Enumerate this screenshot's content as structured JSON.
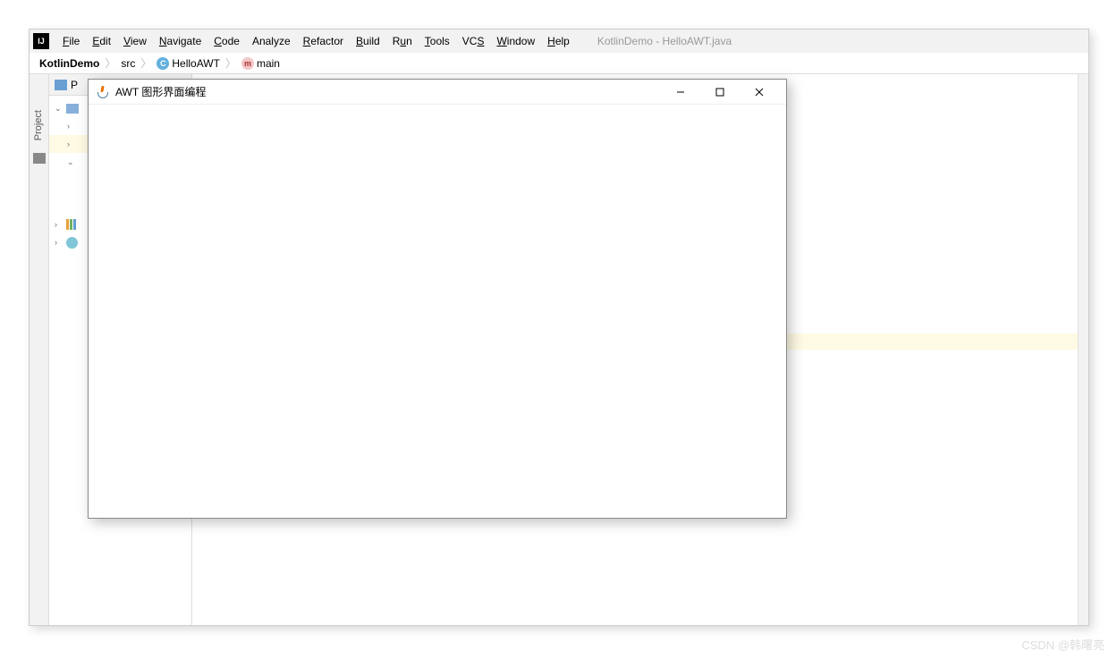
{
  "menu": {
    "items": [
      "File",
      "Edit",
      "View",
      "Navigate",
      "Code",
      "Analyze",
      "Refactor",
      "Build",
      "Run",
      "Tools",
      "VCS",
      "Window",
      "Help"
    ],
    "mnemonics": [
      "F",
      "E",
      "V",
      "N",
      "C",
      "",
      "R",
      "B",
      "R",
      "T",
      "S",
      "W",
      "H"
    ]
  },
  "window_info": "KotlinDemo - HelloAWT.java",
  "breadcrumb": {
    "project": "KotlinDemo",
    "src": "src",
    "file": "HelloAWT",
    "method": "main"
  },
  "side_tab": {
    "label": "Project"
  },
  "project_panel": {
    "header": "P"
  },
  "awt": {
    "title": "AWT 图形界面编程"
  },
  "watermark": "CSDN @韩曙亮"
}
